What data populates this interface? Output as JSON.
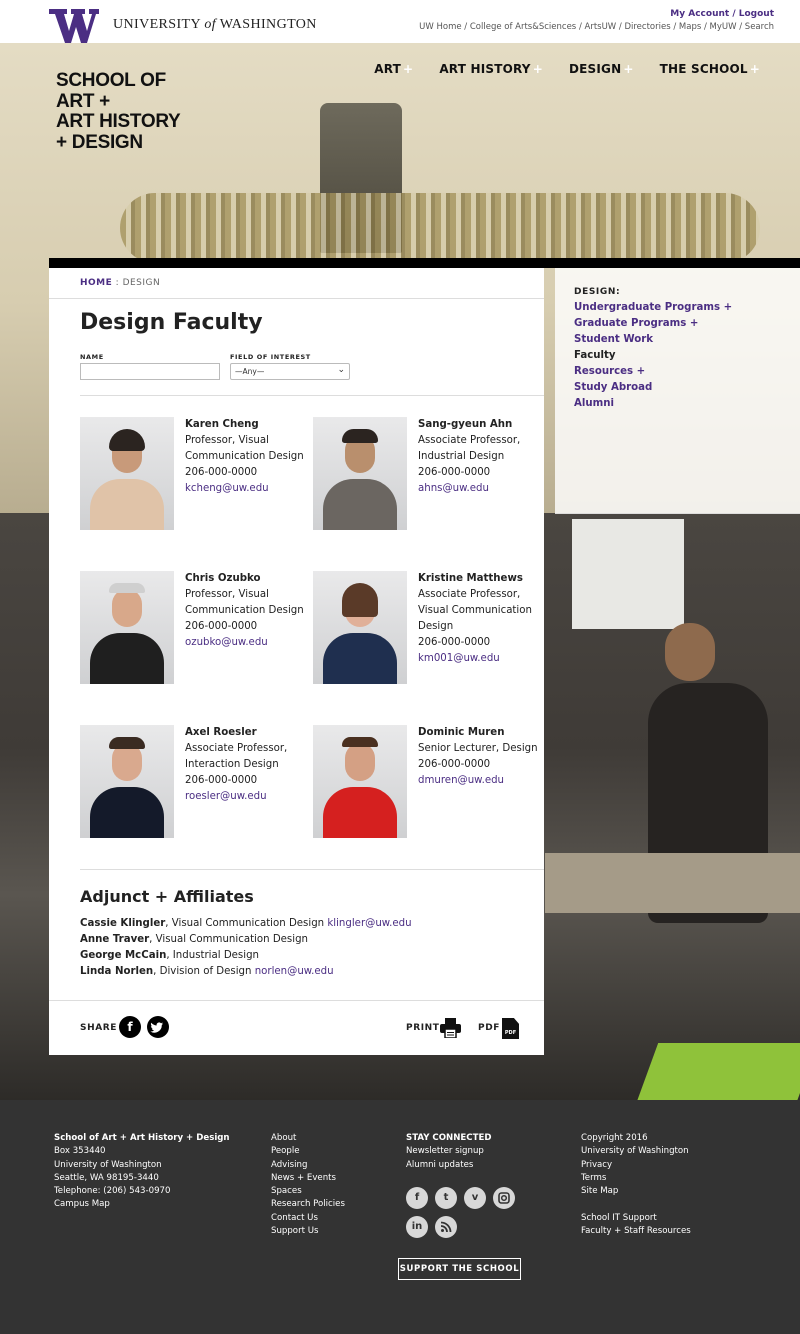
{
  "uw": {
    "wordmark_pre": "UNIVERSITY ",
    "wordmark_of": "of",
    "wordmark_post": " WASHINGTON",
    "account": "My Account / Logout",
    "links": "UW Home / College of Arts&Sciences / ArtsUW / Directories / Maps / MyUW / Search"
  },
  "school_logo": [
    "SCHOOL OF",
    "ART +",
    "ART HISTORY",
    "+ DESIGN"
  ],
  "nav": [
    {
      "label": "ART",
      "plus": "+"
    },
    {
      "label": "ART HISTORY",
      "plus": "+"
    },
    {
      "label": "DESIGN",
      "plus": "+"
    },
    {
      "label": "THE SCHOOL",
      "plus": "+"
    }
  ],
  "breadcrumb": {
    "home": "HOME",
    "sep": " : ",
    "current": "DESIGN"
  },
  "page_title": "Design Faculty",
  "filters": {
    "name_label": "NAME",
    "name_value": "",
    "field_label": "FIELD OF INTEREST",
    "field_value": "—Any—"
  },
  "faculty": [
    {
      "name": "Karen Cheng",
      "title": "Professor, Visual Communication Design",
      "phone": "206-000-0000",
      "email": "kcheng@uw.edu"
    },
    {
      "name": "Sang-gyeun Ahn",
      "title": "Associate Professor, Industrial Design",
      "phone": "206-000-0000",
      "email": "ahns@uw.edu"
    },
    {
      "name": "Chris Ozubko",
      "title": "Professor, Visual Communication Design",
      "phone": "206-000-0000",
      "email": "ozubko@uw.edu"
    },
    {
      "name": "Kristine Matthews",
      "title": "Associate Professor, Visual Communication Design",
      "phone": "206-000-0000",
      "email": "km001@uw.edu"
    },
    {
      "name": "Axel Roesler",
      "title": "Associate Professor, Interaction Design",
      "phone": "206-000-0000",
      "email": "roesler@uw.edu"
    },
    {
      "name": "Dominic Muren",
      "title": "Senior Lecturer, Design",
      "phone": "206-000-0000",
      "email": "dmuren@uw.edu"
    }
  ],
  "adjunct": {
    "title": "Adjunct + Affiliates",
    "people": [
      {
        "name": "Cassie Klingler",
        "role": ", Visual Communication Design ",
        "email": "klingler@uw.edu"
      },
      {
        "name": "Anne Traver",
        "role": ", Visual Communication Design",
        "email": ""
      },
      {
        "name": "George McCain",
        "role": ", Industrial Design",
        "email": ""
      },
      {
        "name": "Linda Norlen",
        "role": ", Division of Design ",
        "email": "norlen@uw.edu"
      }
    ]
  },
  "tools": {
    "share": "SHARE",
    "print": "PRINT",
    "pdf": "PDF",
    "pdf_icon": "PDF"
  },
  "sidenav": {
    "heading": "DESIGN:",
    "items": [
      {
        "label": "Undergraduate Programs +"
      },
      {
        "label": "Graduate Programs +"
      },
      {
        "label": "Student Work"
      },
      {
        "label": "Faculty"
      },
      {
        "label": "Resources +"
      },
      {
        "label": "Study Abroad"
      },
      {
        "label": "Alumni"
      }
    ]
  },
  "footer": {
    "address": [
      "School of Art + Art History + Design",
      "Box 353440",
      "University of Washington",
      "Seattle, WA 98195-3440",
      "Telephone: (206) 543-0970",
      "Campus Map"
    ],
    "links1": [
      "About",
      "People",
      "Advising",
      "News + Events",
      "Spaces",
      "Research Policies",
      "Contact Us",
      "Support Us"
    ],
    "stay_title": "STAY CONNECTED",
    "stay_links": [
      "Newsletter signup",
      "Alumni updates"
    ],
    "legal": [
      "Copyright 2016",
      "University of Washington",
      "Privacy",
      "Terms",
      "Site Map"
    ],
    "support_links": [
      "School IT Support",
      "Faculty + Staff Resources"
    ],
    "support_button": "SUPPORT THE SCHOOL"
  },
  "icons": {
    "social_share": [
      "facebook-icon",
      "twitter-icon"
    ],
    "social_footer": [
      "facebook-icon",
      "twitter-icon",
      "vimeo-icon",
      "instagram-icon",
      "linkedin-icon",
      "rss-icon"
    ]
  },
  "colors": {
    "uw_purple": "#4b2e83",
    "footer_bg": "#333333",
    "accent_green": "#8fc23a"
  }
}
